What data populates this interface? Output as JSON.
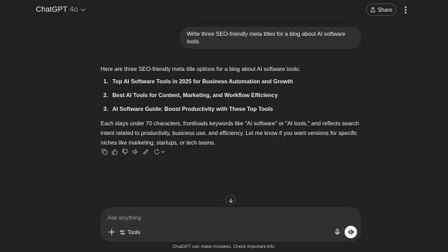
{
  "header": {
    "model_name": "ChatGPT",
    "model_version": "4o",
    "share_label": "Share"
  },
  "conversation": {
    "user_message": "Write three SEO-friendly meta titles for a blog about AI software tools.",
    "assistant": {
      "intro": "Here are three SEO-friendly meta title options for a blog about AI software tools:",
      "items": [
        {
          "num": "1.",
          "text": "Top AI Software Tools in 2025 for Business Automation and Growth"
        },
        {
          "num": "2.",
          "text": "Best AI Tools for Content, Marketing, and Workflow Efficiency"
        },
        {
          "num": "3.",
          "text": "AI Software Guide: Boost Productivity with These Top Tools"
        }
      ],
      "closing": "Each stays under 70 characters, frontloads keywords like \"AI software\" or \"AI tools,\" and reflects search intent related to productivity, business use, and efficiency. Let me know if you want versions for specific niches like marketing, startups, or tech teams."
    }
  },
  "composer": {
    "placeholder": "Ask anything",
    "tools_label": "Tools"
  },
  "footer": {
    "disclaimer": "ChatGPT can make mistakes. Check important info."
  },
  "colors": {
    "background": "#212121",
    "bubble": "#303030",
    "text": "#ececec",
    "muted": "#9b9b9b"
  }
}
